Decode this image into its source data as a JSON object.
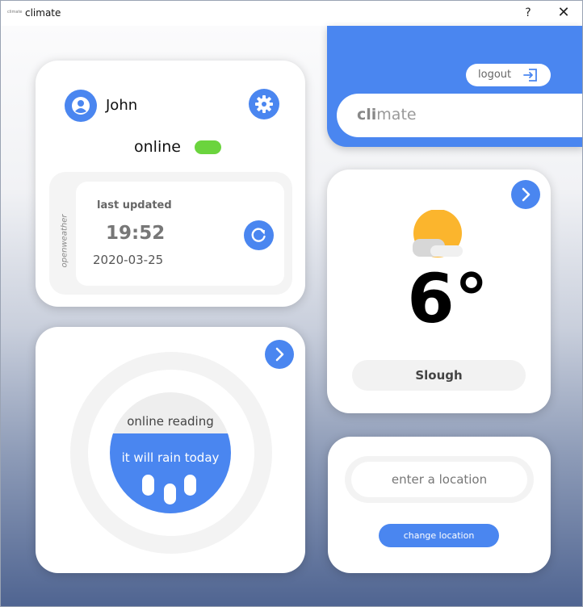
{
  "window": {
    "icon_text": "climate",
    "title": "climate",
    "help_label": "?",
    "close_label": "✕"
  },
  "profile": {
    "user_name": "John",
    "status": "online",
    "status_on": true,
    "provider": "openweather",
    "last_updated_label": "last updated",
    "time": "19:52",
    "date": "2020-03-25"
  },
  "reading": {
    "label": "online reading",
    "forecast": "it will rain today"
  },
  "header": {
    "logout_label": "logout",
    "brand_bold": "cli",
    "brand_rest": "mate"
  },
  "weather": {
    "temperature": "6°",
    "city": "Slough"
  },
  "location": {
    "placeholder": "enter a location",
    "value": "",
    "change_label": "change location"
  },
  "colors": {
    "accent": "#4a86f0",
    "status_on": "#6bd43e",
    "sun": "#fbb52d"
  },
  "icons": {
    "avatar": "user-circle-icon",
    "settings": "gear-icon",
    "refresh": "refresh-icon",
    "arrow": "chevron-right-icon",
    "logout": "logout-icon",
    "weather": "partly-cloudy-icon"
  }
}
